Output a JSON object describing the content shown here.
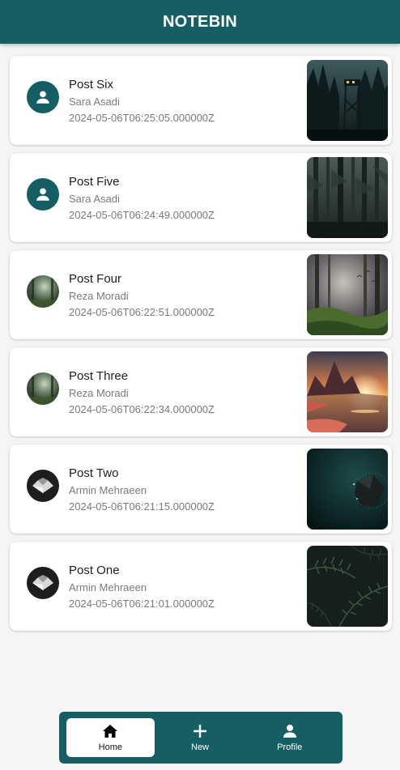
{
  "app": {
    "title": "NOTEBIN"
  },
  "posts": [
    {
      "title": "Post Six",
      "author": "Sara Asadi",
      "date": "2024-05-06T06:25:05.000000Z",
      "avatar": "default-user-avatar",
      "thumbnail": "watchtower-forest-night"
    },
    {
      "title": "Post Five",
      "author": "Sara Asadi",
      "date": "2024-05-06T06:24:49.000000Z",
      "avatar": "default-user-avatar",
      "thumbnail": "dark-pine-forest"
    },
    {
      "title": "Post Four",
      "author": "Reza Moradi",
      "date": "2024-05-06T06:22:51.000000Z",
      "avatar": "misty-forest-avatar",
      "thumbnail": "misty-forest-birds"
    },
    {
      "title": "Post Three",
      "author": "Reza Moradi",
      "date": "2024-05-06T06:22:34.000000Z",
      "avatar": "misty-forest-avatar",
      "thumbnail": "sunset-mountain-lake"
    },
    {
      "title": "Post Two",
      "author": "Armin Mehraeen",
      "date": "2024-05-06T06:21:15.000000Z",
      "avatar": "geometric-logo-avatar",
      "thumbnail": "dark-teal-crystal"
    },
    {
      "title": "Post One",
      "author": "Armin Mehraeen",
      "date": "2024-05-06T06:21:01.000000Z",
      "avatar": "geometric-logo-avatar",
      "thumbnail": "dark-fern-leaves"
    }
  ],
  "nav": {
    "items": [
      {
        "label": "Home",
        "icon": "home-icon",
        "active": true
      },
      {
        "label": "New",
        "icon": "plus-icon",
        "active": false
      },
      {
        "label": "Profile",
        "icon": "person-icon",
        "active": false
      }
    ]
  },
  "colors": {
    "primary": "#155e63",
    "background": "#f5f5f5",
    "card": "#ffffff",
    "text_secondary": "#7a7a7a"
  }
}
